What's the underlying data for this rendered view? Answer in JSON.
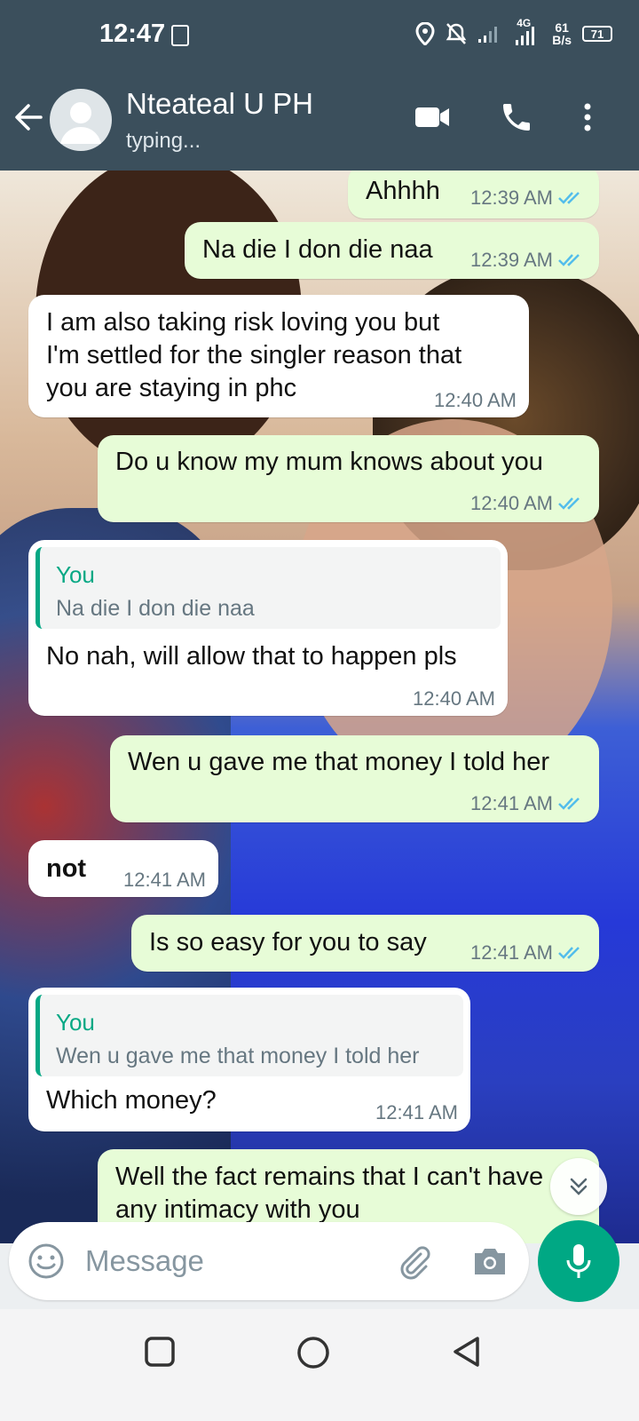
{
  "status_bar": {
    "time": "12:47",
    "signal_label": "4G",
    "net_speed_value": "61",
    "net_speed_unit": "B/s",
    "battery": "71"
  },
  "header": {
    "contact_name": "Nteateal U PH",
    "status": "typing..."
  },
  "messages": [
    {
      "dir": "out",
      "text": "Ahhhh",
      "time": "12:39 AM",
      "read": true
    },
    {
      "dir": "out",
      "text": "Na die I don die naa",
      "time": "12:39 AM",
      "read": true
    },
    {
      "dir": "in",
      "lines": [
        "I am also taking risk loving you but",
        "I'm settled for the singler reason that",
        "you are staying in phc"
      ],
      "time": "12:40 AM"
    },
    {
      "dir": "out",
      "text": "Do u know my mum knows about you",
      "time": "12:40 AM",
      "read": true
    },
    {
      "dir": "in",
      "quote_author": "You",
      "quote_text": "Na die I don die naa",
      "text": "No nah, will allow that to happen pls",
      "time": "12:40 AM"
    },
    {
      "dir": "out",
      "text": "Wen u gave me that money I told her",
      "time": "12:41 AM",
      "read": true
    },
    {
      "dir": "in",
      "text": "not",
      "time": "12:41 AM"
    },
    {
      "dir": "out",
      "text": "Is so easy for you to say",
      "time": "12:41 AM",
      "read": true
    },
    {
      "dir": "in",
      "quote_author": "You",
      "quote_text": "Wen u gave me that money I told her",
      "text": "Which money?",
      "time": "12:41 AM"
    },
    {
      "dir": "out",
      "lines": [
        "Well the fact remains that I can't have",
        "any intimacy with you"
      ],
      "read": true
    }
  ],
  "composer": {
    "placeholder": "Message"
  },
  "colors": {
    "header_bg": "#3b4f5c",
    "outgoing_bubble": "#e7fcd7",
    "incoming_bubble": "#ffffff",
    "accent": "#00a884",
    "read_tick": "#53bdeb"
  }
}
